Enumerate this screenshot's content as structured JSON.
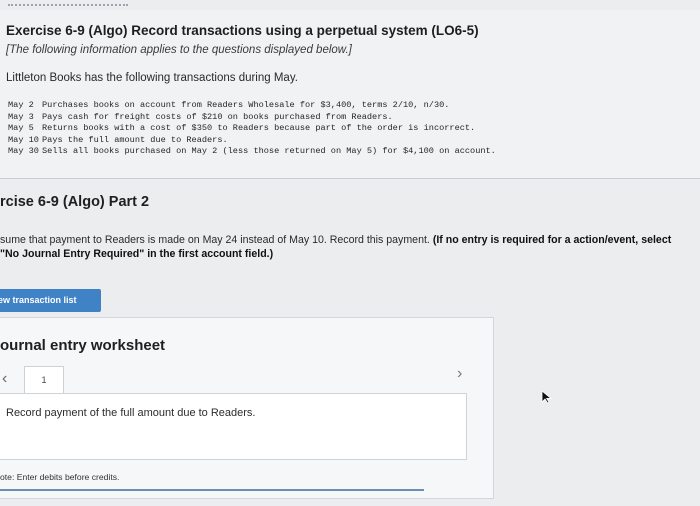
{
  "problem": {
    "title": "Exercise 6-9 (Algo) Record transactions using a perpetual system (LO6-5)",
    "applies_note": "[The following information applies to the questions displayed below.]",
    "intro": "Littleton Books has the following transactions during May.",
    "transactions": [
      {
        "date": "May 2",
        "text": "Purchases books on account from Readers Wholesale for $3,400, terms 2/10, n/30."
      },
      {
        "date": "May 3",
        "text": "Pays cash for freight costs of $210 on books purchased from Readers."
      },
      {
        "date": "May 5",
        "text": "Returns books with a cost of $350 to Readers because part of the order is incorrect."
      },
      {
        "date": "May 10",
        "text": "Pays the full amount due to Readers."
      },
      {
        "date": "May 30",
        "text": "Sells all books purchased on May 2 (less those returned on May 5) for $4,100 on account."
      }
    ]
  },
  "part": {
    "title": "rcise 6-9 (Algo) Part 2",
    "instruction_plain": "sume that payment to Readers is made on May 24 instead of May 10. Record this payment.",
    "instruction_bold": "(If no entry is required for a action/event, select \"No Journal Entry Required\" in the first account field.)"
  },
  "view_button": {
    "label": "ew transaction list"
  },
  "worksheet": {
    "title": "ournal entry worksheet",
    "prev_icon": "chevron-left-icon",
    "next_icon": "chevron-right-icon",
    "page_number": "1",
    "instruction": "Record payment of the full amount due to Readers.",
    "note": "ote: Enter debits before credits."
  },
  "colors": {
    "button_blue": "#3f82c6",
    "background": "#ecedef",
    "underline": "#6d8fb3"
  }
}
